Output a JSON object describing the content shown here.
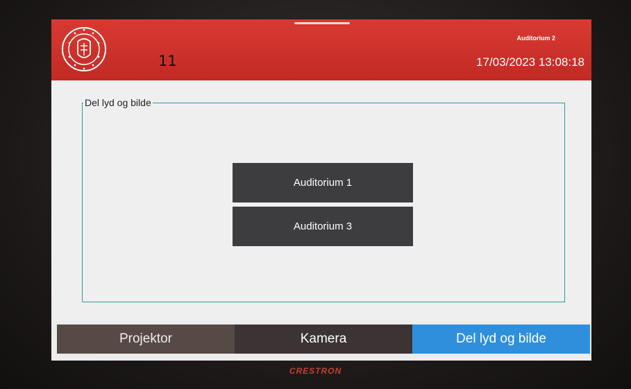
{
  "header": {
    "room_number": "11",
    "room_name": "Auditorium 2",
    "datetime": "17/03/2023 13:08:18",
    "logo_icon": "university-seal-icon",
    "accent_color": "#c8302a"
  },
  "panel": {
    "group_label": "Del lyd og bilde",
    "frame_color": "#2a9b95",
    "buttons": [
      {
        "label": "Auditorium 1"
      },
      {
        "label": "Auditorium 3"
      }
    ]
  },
  "tabs": [
    {
      "label": "Projektor",
      "active": false
    },
    {
      "label": "Kamera",
      "active": false
    },
    {
      "label": "Del lyd og bilde",
      "active": true
    }
  ],
  "device": {
    "brand": "CRESTRON"
  }
}
